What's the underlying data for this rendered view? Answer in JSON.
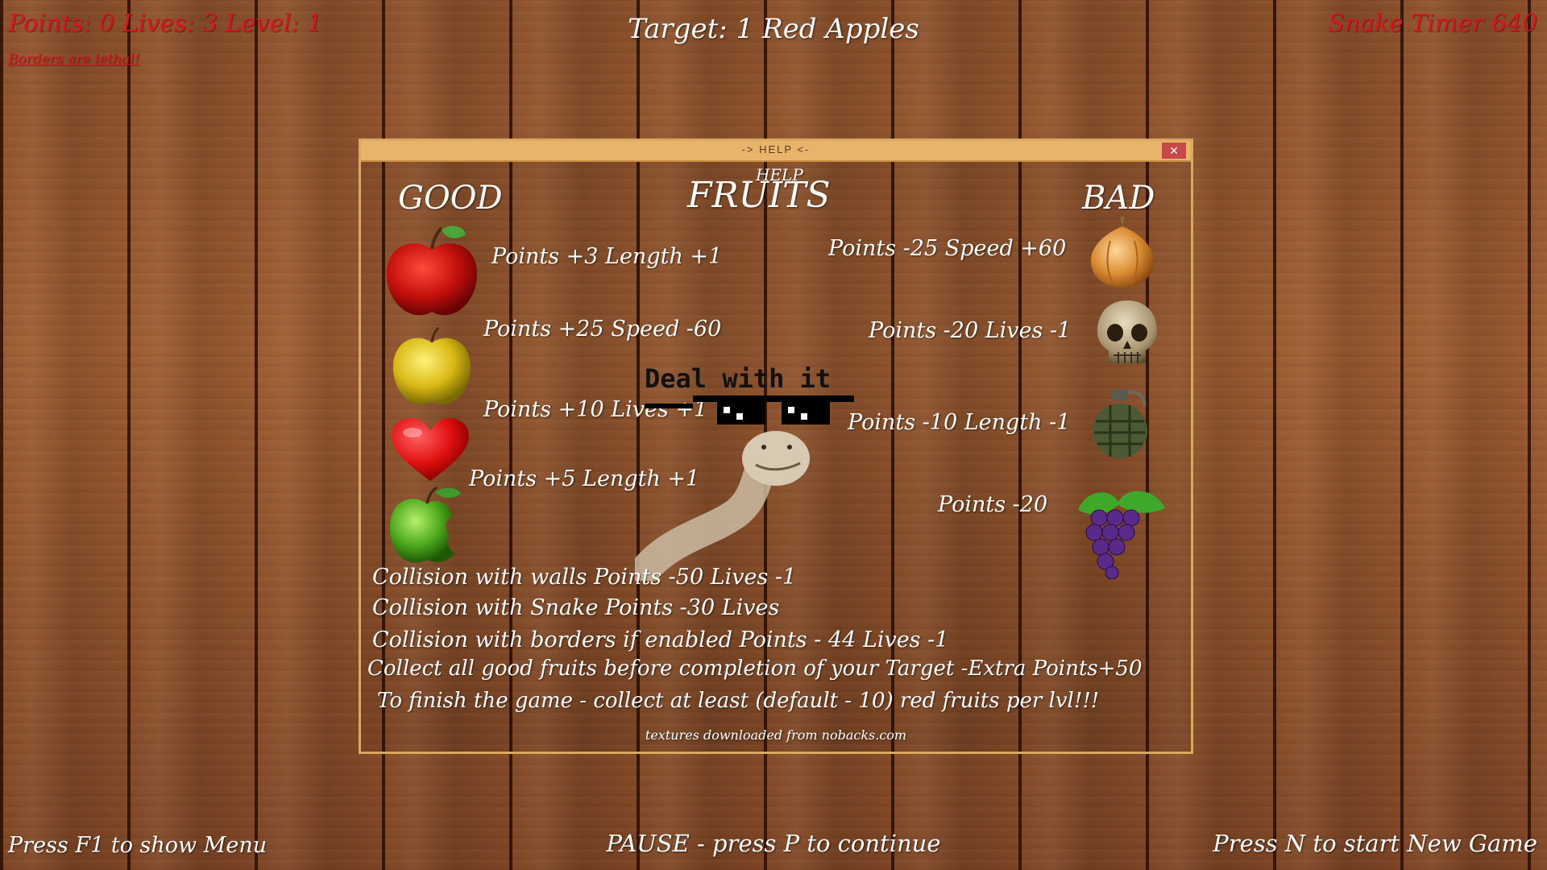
{
  "hud": {
    "points_line": "Points: 0 Lives: 3 Level: 1",
    "borders_line": "Borders are lethal!",
    "target_line": "Target: 1 Red Apples",
    "snake_timer": "Snake Timer 640",
    "menu_hint": "Press F1 to show Menu",
    "pause_hint": "PAUSE - press P to continue",
    "newgame_hint": "Press N to start New Game"
  },
  "help": {
    "window_title": "-> HELP <-",
    "close_label": "✕",
    "heading_small": "HELP",
    "heading_big": "FRUITS",
    "good_label": "GOOD",
    "bad_label": "BAD",
    "meme_text": "Deal with it",
    "good_items": [
      {
        "icon": "red-apple-icon",
        "text": "Points +3  Length +1"
      },
      {
        "icon": "yellow-apple-icon",
        "text": "Points +25 Speed -60"
      },
      {
        "icon": "heart-icon",
        "text": "Points +10 Lives +1"
      },
      {
        "icon": "green-apple-icon",
        "text": "Points +5 Length +1"
      }
    ],
    "bad_items": [
      {
        "icon": "onion-icon",
        "text": "Points -25 Speed +60"
      },
      {
        "icon": "skull-icon",
        "text": "Points -20 Lives -1"
      },
      {
        "icon": "grenade-icon",
        "text": "Points -10 Length -1"
      },
      {
        "icon": "grapes-icon",
        "text": "Points -20"
      }
    ],
    "rules": [
      "Collision with walls Points -50 Lives -1",
      "Collision with Snake Points -30 Lives",
      "Collision with borders if enabled Points - 44 Lives -1",
      "Collect all good fruits before completion of your Target -Extra Points+50",
      "To finish the game - collect at least (default - 10) red fruits per lvl!!!"
    ],
    "credits": "textures downloaded from nobacks.com"
  },
  "colors": {
    "hud_red": "#e0141c",
    "titlebar": "#e8b36a",
    "close_button": "#c74848",
    "wood": "#8a4f2a"
  }
}
